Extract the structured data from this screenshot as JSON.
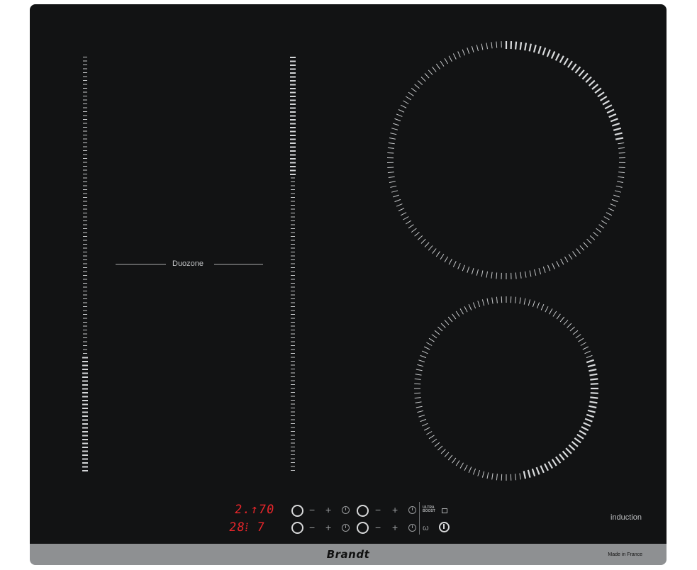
{
  "product": {
    "zone_label": "Duozone",
    "type_label": "induction",
    "brand": "Brandt",
    "origin": "Made in France"
  },
  "displays": {
    "top": "2.↑70",
    "bottom": "28⁞ 7"
  },
  "controls": {
    "minus": "−",
    "plus": "+",
    "ultra_boost_line1": "ULTRA",
    "ultra_boost_line2": "BOOST"
  },
  "colors": {
    "glass": "#121314",
    "frame": "#8e9092",
    "tick": "#c9cbcd",
    "display": "#e8262b"
  },
  "icons": [
    "slider-icon",
    "minus-icon",
    "plus-icon",
    "timer-icon",
    "ring-icon",
    "lock-icon",
    "keep-warm-icon",
    "power-icon"
  ]
}
